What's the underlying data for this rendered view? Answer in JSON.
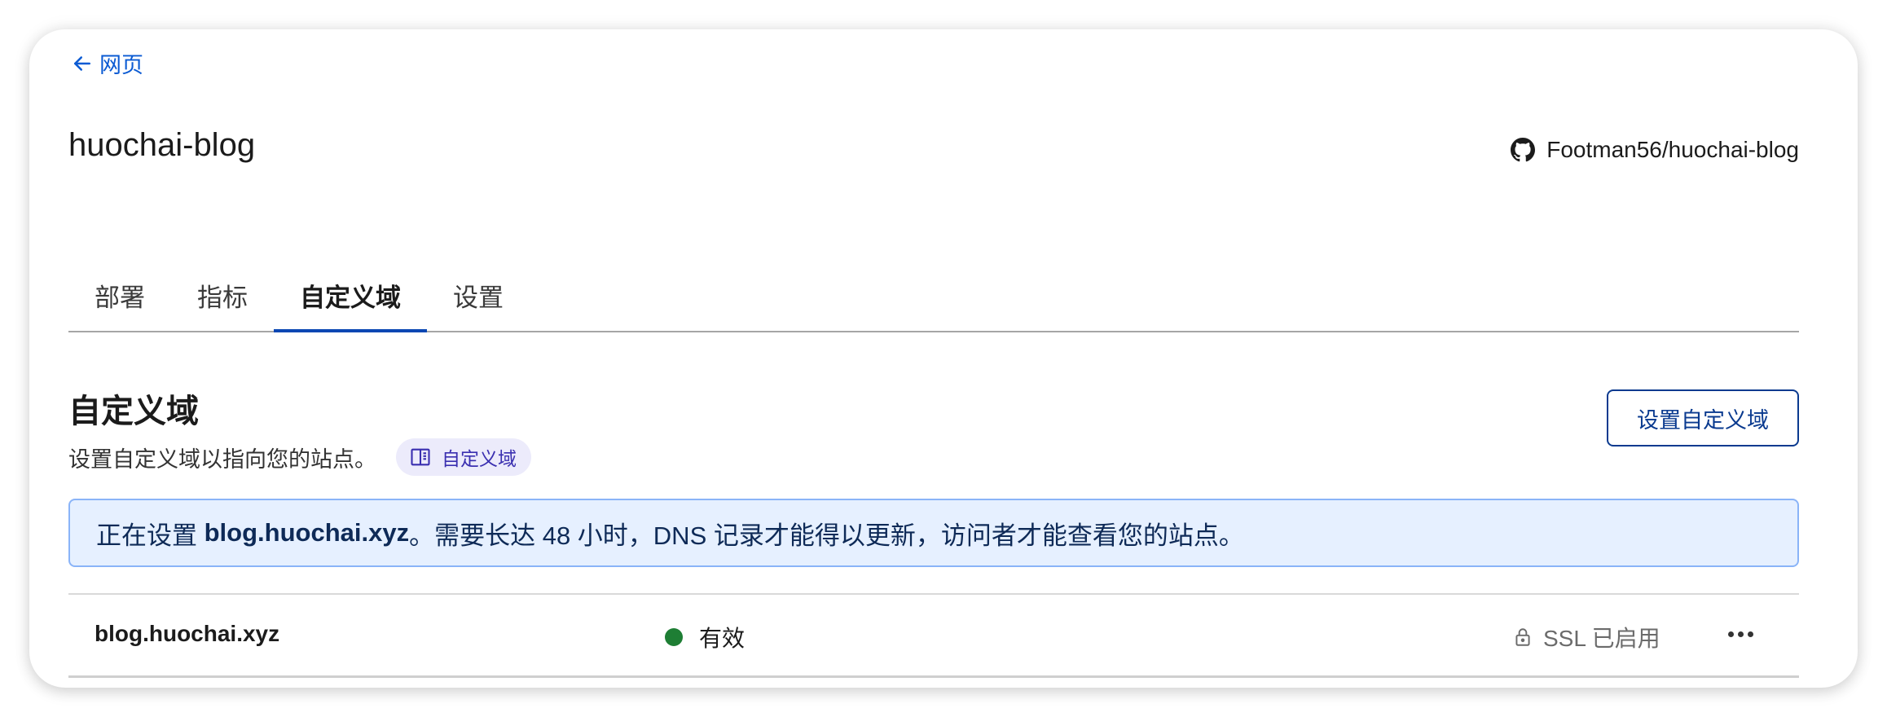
{
  "nav": {
    "back_label": "网页"
  },
  "project": {
    "name": "huochai-blog",
    "repo": "Footman56/huochai-blog"
  },
  "tabs": [
    {
      "label": "部署",
      "active": false
    },
    {
      "label": "指标",
      "active": false
    },
    {
      "label": "自定义域",
      "active": true
    },
    {
      "label": "设置",
      "active": false
    }
  ],
  "section": {
    "title": "自定义域",
    "description": "设置自定义域以指向您的站点。",
    "doc_chip_label": "自定义域",
    "setup_button_label": "设置自定义域"
  },
  "banner": {
    "prefix": "正在设置 ",
    "domain": "blog.huochai.xyz",
    "suffix": "。需要长达 48 小时，DNS 记录才能得以更新，访问者才能查看您的站点。"
  },
  "domains": [
    {
      "name": "blog.huochai.xyz",
      "status": "有效",
      "status_color": "#1e7e34",
      "ssl_label": "SSL 已启用"
    }
  ],
  "colors": {
    "accent": "#0a47b3",
    "link": "#0b5bd3",
    "banner_bg": "#e6f0ff",
    "chip_bg": "#ecebfb"
  }
}
